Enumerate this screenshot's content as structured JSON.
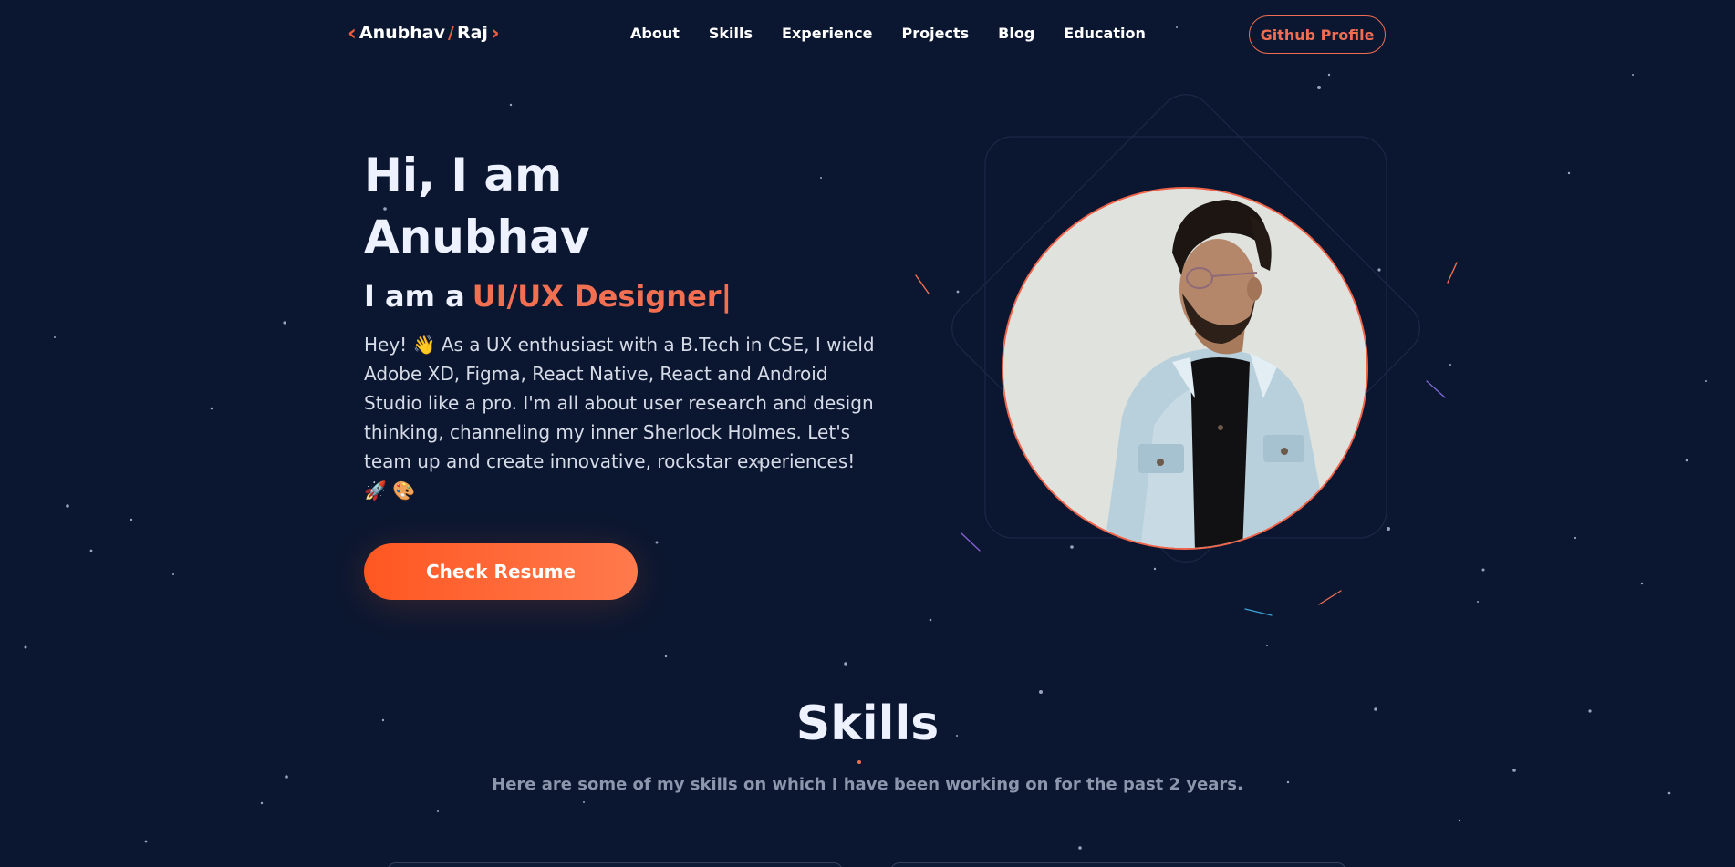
{
  "nav": {
    "logo_left": "Anubhav",
    "logo_slash": "/",
    "logo_right": "Raj",
    "links": [
      "About",
      "Skills",
      "Experience",
      "Projects",
      "Blog",
      "Education"
    ],
    "github_label": "Github Profile"
  },
  "hero": {
    "greeting_line1": "Hi, I am",
    "greeting_line2": "Anubhav",
    "role_prefix": "I am a",
    "role_value": "UI/UX Designer",
    "role_cursor": "|",
    "bio": "Hey! 👋 As a UX enthusiast with a B.Tech in CSE, I wield Adobe XD, Figma, React Native, React and Android Studio like a pro. I'm all about user research and design thinking, channeling my inner Sherlock Holmes. Let's team up and create innovative, rockstar experiences! 🚀 🎨",
    "resume_label": "Check Resume"
  },
  "skills": {
    "title": "Skills",
    "subtitle": "Here are some of my skills on which I have been working on for the past 2 years."
  },
  "colors": {
    "background": "#0b1730",
    "accent": "#f26f52",
    "button_gradient_start": "#ff5722",
    "button_gradient_end": "#ff7a4d"
  },
  "icons": [
    "chevron-left-icon",
    "chevron-right-icon",
    "profile-photo"
  ]
}
